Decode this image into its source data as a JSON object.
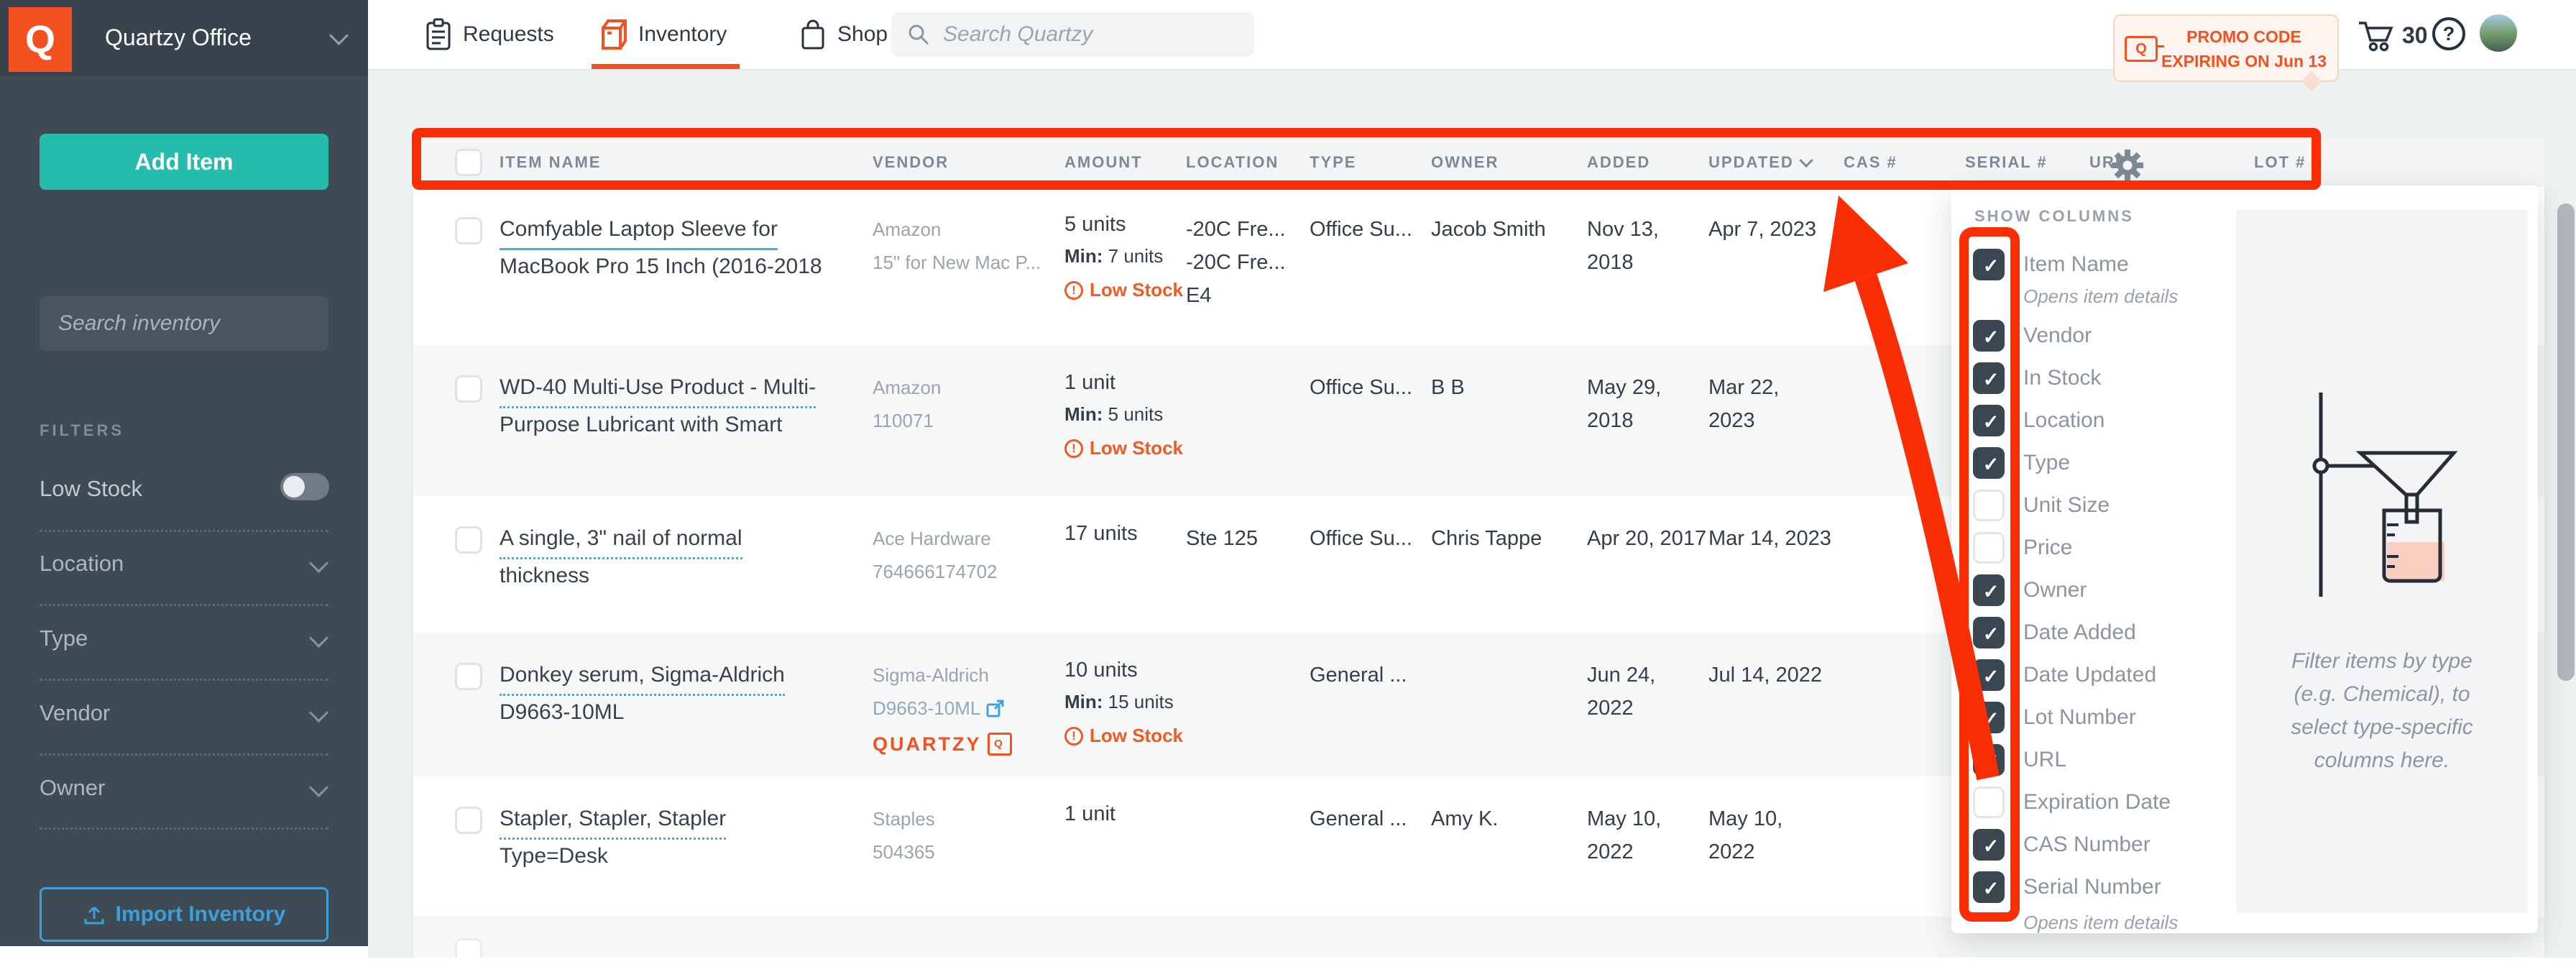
{
  "colors": {
    "annotation": "#fa2e05",
    "brand": "#f4511e",
    "teal": "#26bcab",
    "blue": "#3fa3dd",
    "lowstock": "#f15a24"
  },
  "app": {
    "workspace": "Quartzy Office",
    "logo_letter": "Q"
  },
  "topnav": {
    "tabs": [
      {
        "label": "Requests"
      },
      {
        "label": "Inventory"
      },
      {
        "label": "Shop"
      }
    ],
    "search_placeholder": "Search Quartzy",
    "promo": {
      "line1": "PROMO CODE",
      "line2": "EXPIRING ON Jun 13",
      "tag_letter": "Q"
    },
    "cart_count": "30",
    "help_glyph": "?"
  },
  "sidebar": {
    "add_item_label": "Add Item",
    "search_placeholder": "Search inventory",
    "filters_heading": "FILTERS",
    "low_stock_label": "Low Stock",
    "groups": [
      {
        "label": "Location"
      },
      {
        "label": "Type"
      },
      {
        "label": "Vendor"
      },
      {
        "label": "Owner"
      }
    ],
    "import_label": "Import Inventory"
  },
  "table": {
    "headers": [
      "ITEM NAME",
      "VENDOR",
      "AMOUNT",
      "LOCATION",
      "TYPE",
      "OWNER",
      "ADDED",
      "UPDATED",
      "CAS #",
      "SERIAL #",
      "URL",
      "LOT #"
    ],
    "min_label": "Min:",
    "low_stock_label": "Low Stock",
    "rows": [
      {
        "name1": "Comfyable Laptop Sleeve for",
        "name2": "MacBook Pro 15 Inch (2016-2018",
        "vendor": "Amazon",
        "vendor_sub": "15\" for New Mac P...",
        "amount": "5 units",
        "min": "7 units",
        "location": "-20C Fre...\n-20C Fre...\nE4",
        "type": "Office Su...",
        "owner": "Jacob Smith",
        "added": "Nov 13, 2018",
        "updated": "Apr 7, 2023"
      },
      {
        "name1": "WD-40 Multi-Use Product - Multi-",
        "name2": "Purpose Lubricant with Smart",
        "vendor": "Amazon",
        "vendor_sub": "110071",
        "amount": "1 unit",
        "min": "5 units",
        "location": "",
        "type": "Office Su...",
        "owner": "B B",
        "added": "May 29,\n2018",
        "updated": "Mar 22,\n2023"
      },
      {
        "name1": "A single, 3\" nail of normal",
        "name2": "thickness",
        "vendor": "Ace Hardware",
        "vendor_sub": "764666174702",
        "amount": "17 units",
        "location": "Ste 125",
        "type": "Office Su...",
        "owner": "Chris Tappe",
        "added": "Apr 20, 2017",
        "updated": "Mar 14, 2023"
      },
      {
        "name1": "Donkey serum, Sigma-Aldrich",
        "name2": "D9663-10ML",
        "vendor": "Sigma-Aldrich",
        "catalog": "D9663-10ML",
        "brand": "QUARTZY",
        "brand_letter": "Q",
        "amount": "10 units",
        "min": "15 units",
        "location": "",
        "type": "General ...",
        "owner": "",
        "added": "Jun 24,\n2022",
        "updated": "Jul 14, 2022"
      },
      {
        "name1": "Stapler, Stapler, Stapler",
        "name2": "Type=Desk",
        "vendor": "Staples",
        "vendor_sub": "504365",
        "amount": "1 unit",
        "location": "",
        "type": "General ...",
        "owner": "Amy K.",
        "added": "May 10,\n2022",
        "updated": "May 10,\n2022"
      }
    ]
  },
  "columns_panel": {
    "title": "SHOW COLUMNS",
    "items": [
      {
        "label": "Item Name",
        "checked": true,
        "sub": "Opens item details"
      },
      {
        "label": "Vendor",
        "checked": true
      },
      {
        "label": "In Stock",
        "checked": true
      },
      {
        "label": "Location",
        "checked": true
      },
      {
        "label": "Type",
        "checked": true
      },
      {
        "label": "Unit Size",
        "checked": false
      },
      {
        "label": "Price",
        "checked": false
      },
      {
        "label": "Owner",
        "checked": true
      },
      {
        "label": "Date Added",
        "checked": true
      },
      {
        "label": "Date Updated",
        "checked": true
      },
      {
        "label": "Lot Number",
        "checked": true
      },
      {
        "label": "URL",
        "checked": true
      },
      {
        "label": "Expiration Date",
        "checked": false
      },
      {
        "label": "CAS Number",
        "checked": true
      },
      {
        "label": "Serial Number",
        "checked": true
      }
    ],
    "footnote": "Opens item details",
    "hint_line1": "Filter items by type",
    "hint_line2": "(e.g. Chemical), to",
    "hint_line3": "select type-specific",
    "hint_line4": "columns here."
  }
}
